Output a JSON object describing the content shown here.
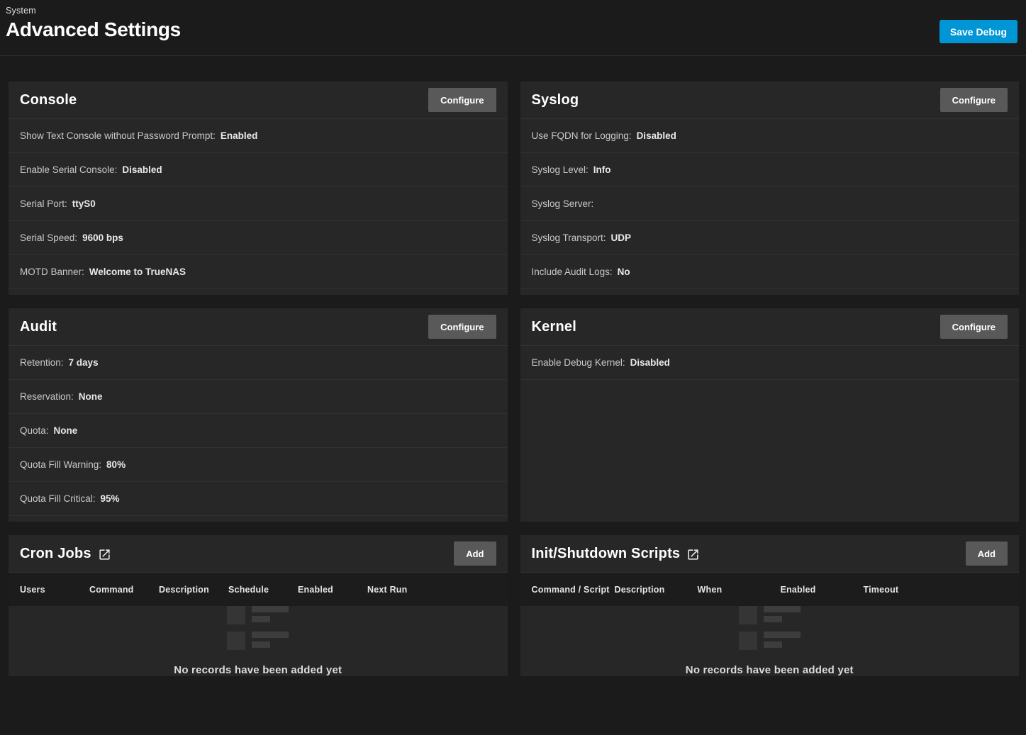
{
  "page": {
    "breadcrumb": "System",
    "title": "Advanced Settings"
  },
  "toolbar": {
    "save_debug_label": "Save Debug"
  },
  "cards": {
    "console": {
      "title": "Console",
      "action_label": "Configure",
      "rows": [
        {
          "label": "Show Text Console without Password Prompt:",
          "value": "Enabled"
        },
        {
          "label": "Enable Serial Console:",
          "value": "Disabled"
        },
        {
          "label": "Serial Port:",
          "value": "ttyS0"
        },
        {
          "label": "Serial Speed:",
          "value": "9600 bps"
        },
        {
          "label": "MOTD Banner:",
          "value": "Welcome to TrueNAS"
        }
      ]
    },
    "syslog": {
      "title": "Syslog",
      "action_label": "Configure",
      "rows": [
        {
          "label": "Use FQDN for Logging:",
          "value": "Disabled"
        },
        {
          "label": "Syslog Level:",
          "value": "Info"
        },
        {
          "label": "Syslog Server:",
          "value": ""
        },
        {
          "label": "Syslog Transport:",
          "value": "UDP"
        },
        {
          "label": "Include Audit Logs:",
          "value": "No"
        }
      ]
    },
    "audit": {
      "title": "Audit",
      "action_label": "Configure",
      "rows": [
        {
          "label": "Retention:",
          "value": "7 days"
        },
        {
          "label": "Reservation:",
          "value": "None"
        },
        {
          "label": "Quota:",
          "value": "None"
        },
        {
          "label": "Quota Fill Warning:",
          "value": "80%"
        },
        {
          "label": "Quota Fill Critical:",
          "value": "95%"
        }
      ]
    },
    "kernel": {
      "title": "Kernel",
      "action_label": "Configure",
      "rows": [
        {
          "label": "Enable Debug Kernel:",
          "value": "Disabled"
        }
      ]
    },
    "cron_jobs": {
      "title": "Cron Jobs",
      "action_label": "Add",
      "icon": "open-in-new-icon",
      "columns": [
        "Users",
        "Command",
        "Description",
        "Schedule",
        "Enabled",
        "Next Run"
      ],
      "empty_text": "No records have been added yet"
    },
    "init_shutdown": {
      "title": "Init/Shutdown Scripts",
      "action_label": "Add",
      "icon": "open-in-new-icon",
      "columns": [
        "Command / Script",
        "Description",
        "When",
        "Enabled",
        "Timeout"
      ],
      "empty_text": "No records have been added yet"
    }
  },
  "colors": {
    "accent_blue": "#0095d5",
    "page_bg": "#1b1b1b",
    "card_bg": "#272727",
    "button_gray": "#595959",
    "table_header_bg": "#1c1c1c"
  }
}
